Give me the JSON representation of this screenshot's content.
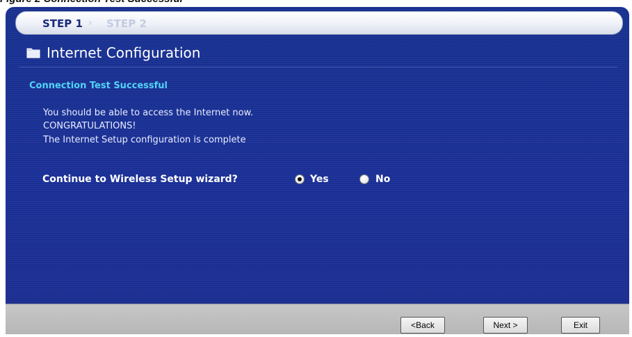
{
  "caption": "Figure 2   Connection Test Successful",
  "wizard": {
    "steps": [
      {
        "label": "STEP 1",
        "active": true
      },
      {
        "label": "STEP 2",
        "active": false
      }
    ],
    "title": "Internet Configuration",
    "title_icon": "folder-icon",
    "status_heading": "Connection Test Successful",
    "messages": [
      "You should be able to access the Internet now.",
      "CONGRATULATIONS!",
      "The Internet Setup configuration is complete"
    ],
    "question": "Continue to Wireless Setup wizard?",
    "options": [
      {
        "label": "Yes",
        "selected": true
      },
      {
        "label": "No",
        "selected": false
      }
    ]
  },
  "buttons": {
    "back": "<Back",
    "next": "Next >",
    "exit": "Exit"
  },
  "colors": {
    "panel_background": "#1a2f96",
    "heading_cyan": "#52d4f7",
    "footer_gray": "#bdbdbd"
  }
}
